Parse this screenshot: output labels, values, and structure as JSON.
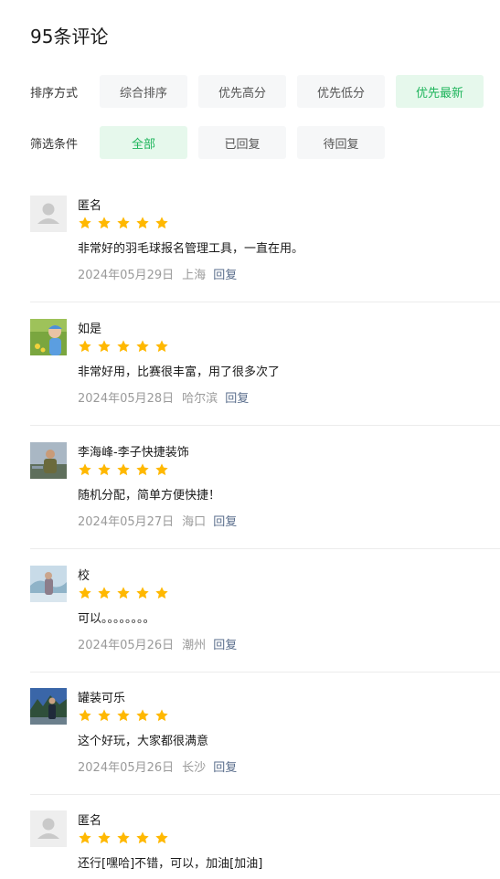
{
  "header": {
    "title": "95条评论"
  },
  "sort": {
    "label": "排序方式",
    "options": [
      "综合排序",
      "优先高分",
      "优先低分",
      "优先最新"
    ],
    "selected": "优先最新"
  },
  "filter": {
    "label": "筛选条件",
    "options": [
      "全部",
      "已回复",
      "待回复"
    ],
    "selected": "全部"
  },
  "colors": {
    "accent_green": "#1fb55c",
    "star": "#ffb800",
    "reply_link": "#5a6e8c"
  },
  "reviews": [
    {
      "user": "匿名",
      "avatar": "default-avatar-icon",
      "rating": 5,
      "text": "非常好的羽毛球报名管理工具，一直在用。",
      "date": "2024年05月29日",
      "location": "上海",
      "reply": "回复"
    },
    {
      "user": "如是",
      "avatar": "photo-avatar",
      "rating": 5,
      "text": "非常好用，比赛很丰富，用了很多次了",
      "date": "2024年05月28日",
      "location": "哈尔滨",
      "reply": "回复"
    },
    {
      "user": "李海峰-李子快捷装饰",
      "avatar": "photo-avatar",
      "rating": 5,
      "text": "随机分配，简单方便快捷！",
      "date": "2024年05月27日",
      "location": "海口",
      "reply": "回复"
    },
    {
      "user": "校",
      "avatar": "photo-avatar",
      "rating": 5,
      "text": "可以。。。。。。。。",
      "date": "2024年05月26日",
      "location": "潮州",
      "reply": "回复"
    },
    {
      "user": "罐装可乐",
      "avatar": "photo-avatar",
      "rating": 5,
      "text": "这个好玩，大家都很满意",
      "date": "2024年05月26日",
      "location": "长沙",
      "reply": "回复"
    },
    {
      "user": "匿名",
      "avatar": "default-avatar-icon",
      "rating": 5,
      "text": "还行[嘿哈]不错，可以，加油[加油]",
      "date": "",
      "location": "",
      "reply": ""
    }
  ]
}
